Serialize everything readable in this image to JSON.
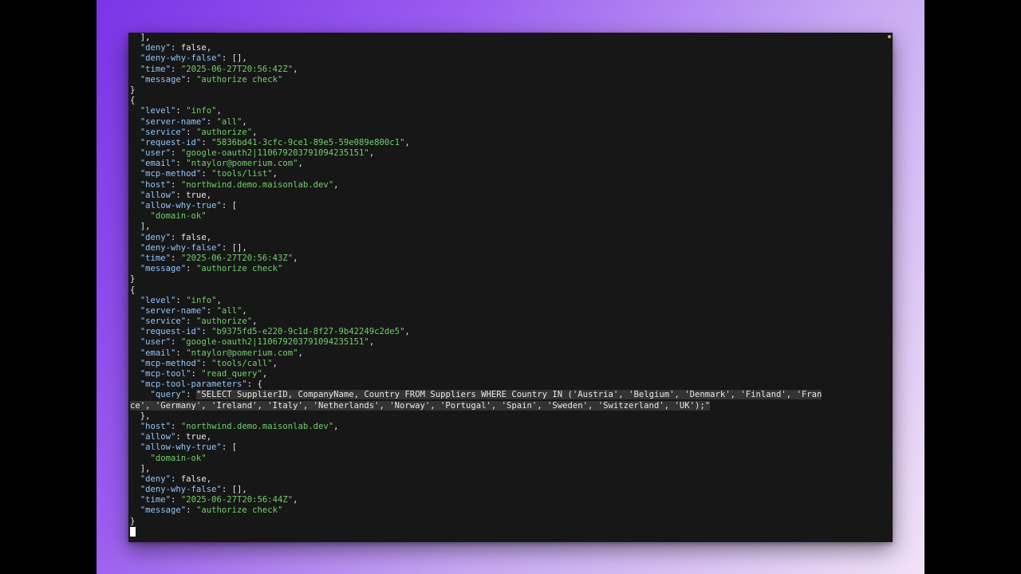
{
  "terminal": {
    "lines": [
      [
        [
          "p",
          "  ],"
        ]
      ],
      [
        [
          "p",
          "  "
        ],
        [
          "k",
          "\"deny\""
        ],
        [
          "p",
          ": false,"
        ]
      ],
      [
        [
          "p",
          "  "
        ],
        [
          "k",
          "\"deny-why-false\""
        ],
        [
          "p",
          ": [],"
        ]
      ],
      [
        [
          "p",
          "  "
        ],
        [
          "k",
          "\"time\""
        ],
        [
          "p",
          ": "
        ],
        [
          "s",
          "\"2025-06-27T20:56:42Z\""
        ],
        [
          "p",
          ","
        ]
      ],
      [
        [
          "p",
          "  "
        ],
        [
          "k",
          "\"message\""
        ],
        [
          "p",
          ": "
        ],
        [
          "s",
          "\"authorize check\""
        ]
      ],
      [
        [
          "p",
          "}"
        ]
      ],
      [
        [
          "p",
          "{"
        ]
      ],
      [
        [
          "p",
          "  "
        ],
        [
          "k",
          "\"level\""
        ],
        [
          "p",
          ": "
        ],
        [
          "s",
          "\"info\""
        ],
        [
          "p",
          ","
        ]
      ],
      [
        [
          "p",
          "  "
        ],
        [
          "k",
          "\"server-name\""
        ],
        [
          "p",
          ": "
        ],
        [
          "s",
          "\"all\""
        ],
        [
          "p",
          ","
        ]
      ],
      [
        [
          "p",
          "  "
        ],
        [
          "k",
          "\"service\""
        ],
        [
          "p",
          ": "
        ],
        [
          "s",
          "\"authorize\""
        ],
        [
          "p",
          ","
        ]
      ],
      [
        [
          "p",
          "  "
        ],
        [
          "k",
          "\"request-id\""
        ],
        [
          "p",
          ": "
        ],
        [
          "s",
          "\"5836bd41-3cfc-9ce1-89e5-59e089e800c1\""
        ],
        [
          "p",
          ","
        ]
      ],
      [
        [
          "p",
          "  "
        ],
        [
          "k",
          "\"user\""
        ],
        [
          "p",
          ": "
        ],
        [
          "s",
          "\"google-oauth2|110679203791094235151\""
        ],
        [
          "p",
          ","
        ]
      ],
      [
        [
          "p",
          "  "
        ],
        [
          "k",
          "\"email\""
        ],
        [
          "p",
          ": "
        ],
        [
          "s",
          "\"ntaylor@pomerium.com\""
        ],
        [
          "p",
          ","
        ]
      ],
      [
        [
          "p",
          "  "
        ],
        [
          "k",
          "\"mcp-method\""
        ],
        [
          "p",
          ": "
        ],
        [
          "s",
          "\"tools/list\""
        ],
        [
          "p",
          ","
        ]
      ],
      [
        [
          "p",
          "  "
        ],
        [
          "k",
          "\"host\""
        ],
        [
          "p",
          ": "
        ],
        [
          "s",
          "\"northwind.demo.maisonlab.dev\""
        ],
        [
          "p",
          ","
        ]
      ],
      [
        [
          "p",
          "  "
        ],
        [
          "k",
          "\"allow\""
        ],
        [
          "p",
          ": true,"
        ]
      ],
      [
        [
          "p",
          "  "
        ],
        [
          "k",
          "\"allow-why-true\""
        ],
        [
          "p",
          ": ["
        ]
      ],
      [
        [
          "p",
          "    "
        ],
        [
          "s",
          "\"domain-ok\""
        ]
      ],
      [
        [
          "p",
          "  ],"
        ]
      ],
      [
        [
          "p",
          "  "
        ],
        [
          "k",
          "\"deny\""
        ],
        [
          "p",
          ": false,"
        ]
      ],
      [
        [
          "p",
          "  "
        ],
        [
          "k",
          "\"deny-why-false\""
        ],
        [
          "p",
          ": [],"
        ]
      ],
      [
        [
          "p",
          "  "
        ],
        [
          "k",
          "\"time\""
        ],
        [
          "p",
          ": "
        ],
        [
          "s",
          "\"2025-06-27T20:56:43Z\""
        ],
        [
          "p",
          ","
        ]
      ],
      [
        [
          "p",
          "  "
        ],
        [
          "k",
          "\"message\""
        ],
        [
          "p",
          ": "
        ],
        [
          "s",
          "\"authorize check\""
        ]
      ],
      [
        [
          "p",
          "}"
        ]
      ],
      [
        [
          "p",
          "{"
        ]
      ],
      [
        [
          "p",
          "  "
        ],
        [
          "k",
          "\"level\""
        ],
        [
          "p",
          ": "
        ],
        [
          "s",
          "\"info\""
        ],
        [
          "p",
          ","
        ]
      ],
      [
        [
          "p",
          "  "
        ],
        [
          "k",
          "\"server-name\""
        ],
        [
          "p",
          ": "
        ],
        [
          "s",
          "\"all\""
        ],
        [
          "p",
          ","
        ]
      ],
      [
        [
          "p",
          "  "
        ],
        [
          "k",
          "\"service\""
        ],
        [
          "p",
          ": "
        ],
        [
          "s",
          "\"authorize\""
        ],
        [
          "p",
          ","
        ]
      ],
      [
        [
          "p",
          "  "
        ],
        [
          "k",
          "\"request-id\""
        ],
        [
          "p",
          ": "
        ],
        [
          "s",
          "\"b9375fd5-e220-9c1d-8f27-9b42249c2de5\""
        ],
        [
          "p",
          ","
        ]
      ],
      [
        [
          "p",
          "  "
        ],
        [
          "k",
          "\"user\""
        ],
        [
          "p",
          ": "
        ],
        [
          "s",
          "\"google-oauth2|110679203791094235151\""
        ],
        [
          "p",
          ","
        ]
      ],
      [
        [
          "p",
          "  "
        ],
        [
          "k",
          "\"email\""
        ],
        [
          "p",
          ": "
        ],
        [
          "s",
          "\"ntaylor@pomerium.com\""
        ],
        [
          "p",
          ","
        ]
      ],
      [
        [
          "p",
          "  "
        ],
        [
          "k",
          "\"mcp-method\""
        ],
        [
          "p",
          ": "
        ],
        [
          "s",
          "\"tools/call\""
        ],
        [
          "p",
          ","
        ]
      ],
      [
        [
          "p",
          "  "
        ],
        [
          "k",
          "\"mcp-tool\""
        ],
        [
          "p",
          ": "
        ],
        [
          "s",
          "\"read_query\""
        ],
        [
          "p",
          ","
        ]
      ],
      [
        [
          "p",
          "  "
        ],
        [
          "k",
          "\"mcp-tool-parameters\""
        ],
        [
          "p",
          ": {"
        ]
      ],
      [
        [
          "p",
          "    "
        ],
        [
          "k",
          "\"query\""
        ],
        [
          "p",
          ": "
        ],
        [
          "h",
          "\"SELECT SupplierID, CompanyName, Country FROM Suppliers WHERE Country IN ('Austria', 'Belgium', 'Denmark', 'Finland', 'Fran"
        ]
      ],
      [
        [
          "h",
          "ce', 'Germany', 'Ireland', 'Italy', 'Netherlands', 'Norway', 'Portugal', 'Spain', 'Sweden', 'Switzerland', 'UK');\""
        ]
      ],
      [
        [
          "p",
          "  },"
        ]
      ],
      [
        [
          "p",
          "  "
        ],
        [
          "k",
          "\"host\""
        ],
        [
          "p",
          ": "
        ],
        [
          "s",
          "\"northwind.demo.maisonlab.dev\""
        ],
        [
          "p",
          ","
        ]
      ],
      [
        [
          "p",
          "  "
        ],
        [
          "k",
          "\"allow\""
        ],
        [
          "p",
          ": true,"
        ]
      ],
      [
        [
          "p",
          "  "
        ],
        [
          "k",
          "\"allow-why-true\""
        ],
        [
          "p",
          ": ["
        ]
      ],
      [
        [
          "p",
          "    "
        ],
        [
          "s",
          "\"domain-ok\""
        ]
      ],
      [
        [
          "p",
          "  ],"
        ]
      ],
      [
        [
          "p",
          "  "
        ],
        [
          "k",
          "\"deny\""
        ],
        [
          "p",
          ": false,"
        ]
      ],
      [
        [
          "p",
          "  "
        ],
        [
          "k",
          "\"deny-why-false\""
        ],
        [
          "p",
          ": [],"
        ]
      ],
      [
        [
          "p",
          "  "
        ],
        [
          "k",
          "\"time\""
        ],
        [
          "p",
          ": "
        ],
        [
          "s",
          "\"2025-06-27T20:56:44Z\""
        ],
        [
          "p",
          ","
        ]
      ],
      [
        [
          "p",
          "  "
        ],
        [
          "k",
          "\"message\""
        ],
        [
          "p",
          ": "
        ],
        [
          "s",
          "\"authorize check\""
        ]
      ],
      [
        [
          "p",
          "}"
        ]
      ]
    ]
  },
  "colors": {
    "key": "#8fc6ff",
    "string": "#6fd06a",
    "text": "#e6e6e6",
    "background": "#171717"
  },
  "icons": {
    "cursor": "block-cursor-icon"
  }
}
